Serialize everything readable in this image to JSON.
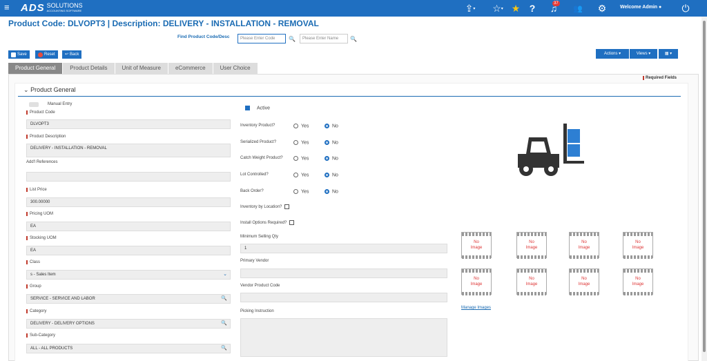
{
  "topbar": {
    "logo_main": "ADS",
    "logo_sub": "SOLUTIONS",
    "logo_tag": "ACCOUNTING SOFTWARE",
    "notifications_count": "37",
    "welcome": "Welcome Admin"
  },
  "header": {
    "title": "Product Code:  DLVOPT3 | Description: DELIVERY - INSTALLATION - REMOVAL",
    "find_label": "Find Product Code/Desc",
    "code_placeholder": "Please Enter Code",
    "name_placeholder": "Please Enter Name"
  },
  "toolbar": {
    "save": "Save",
    "reset": "Reset",
    "back": "Back",
    "actions": "Actions ▾",
    "views": "Views ▾",
    "grid": "▦ ▾"
  },
  "tabs": [
    "Product General",
    "Product Details",
    "Unit of Measure",
    "eCommerce",
    "User Choice"
  ],
  "required_fields": "Required Fields",
  "section": {
    "title": "Product General"
  },
  "left": {
    "manual_entry": "Manual Entry",
    "product_code_label": "Product Code",
    "product_code": "DLVOPT3",
    "description_label": "Product Description",
    "description": "DELIVERY -  INSTALLATION - REMOVAL",
    "addl_ref_label": "Add'l References",
    "addl_ref": "",
    "list_price_label": "List Price",
    "list_price": "300.00000",
    "pricing_uom_label": "Pricing UOM",
    "pricing_uom": "EA",
    "stocking_uom_label": "Stocking UOM",
    "stocking_uom": "EA",
    "class_label": "Class",
    "class": "s - Sales Item",
    "group_label": "Group",
    "group": "SERVICE - SERVICE AND LABOR",
    "category_label": "Category",
    "category": "DELIVERY - DELIVERY OPTIONS",
    "subcategory_label": "Sub-Category",
    "subcategory": "ALL - ALL PRODUCTS"
  },
  "middle": {
    "active": "Active",
    "yes": "Yes",
    "no": "No",
    "inventory_product": "Inventory Product?",
    "serialized_product": "Serialized Product?",
    "catch_weight": "Catch Weight Product?",
    "lot_controlled": "Lot Controlled?",
    "back_order": "Back Order?",
    "inventory_by_location": "Inventory by Location?",
    "install_options": "Install Options Required?",
    "min_qty_label": "Minimum Selling Qty",
    "min_qty": "1",
    "primary_vendor_label": "Primary Vendor",
    "primary_vendor": "",
    "vendor_code_label": "Vendor Product Code",
    "vendor_code": "",
    "picking_label": "Picking Instruction",
    "picking": ""
  },
  "right": {
    "no_image_line1": "No",
    "no_image_line2": "Image",
    "manage_images": "Manage Images"
  },
  "colors": {
    "brand": "#1f6fc1",
    "required": "#c0392b"
  }
}
